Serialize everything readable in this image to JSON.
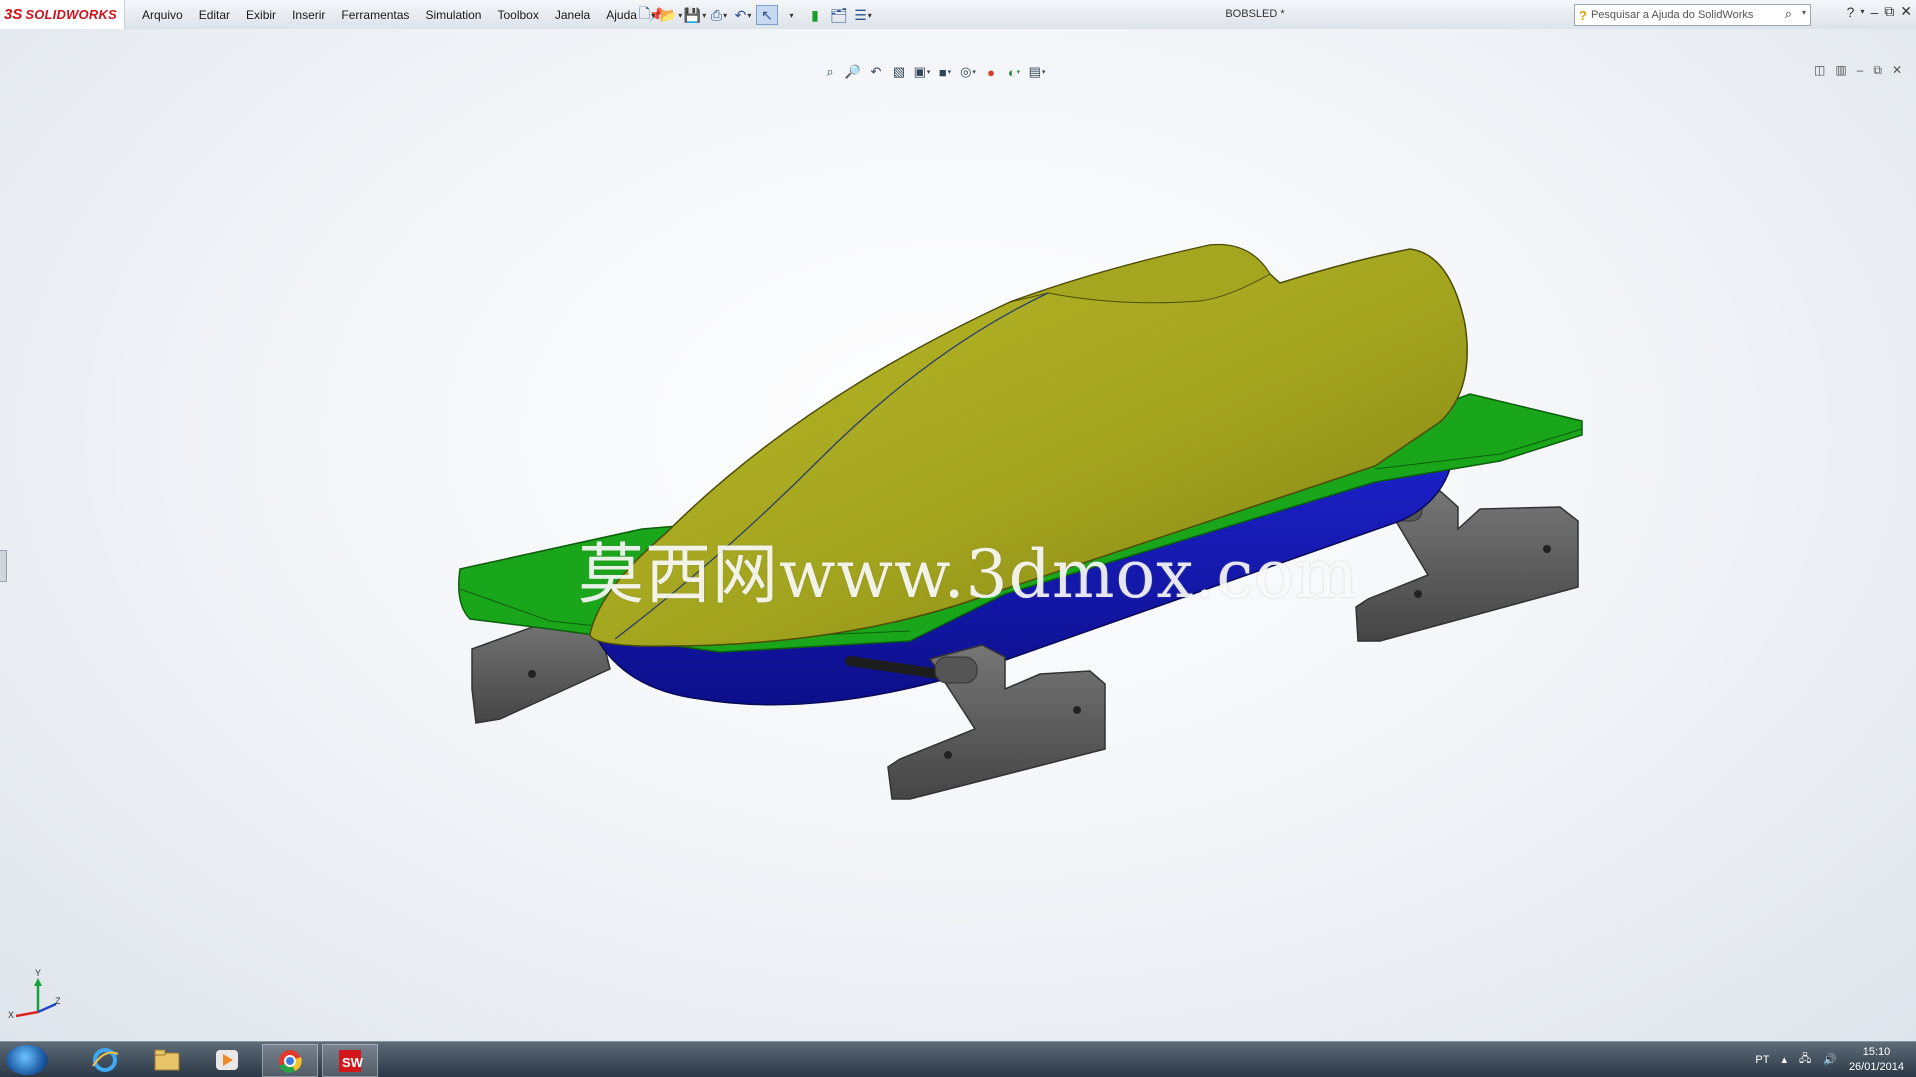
{
  "app": {
    "logo_ds": "3S",
    "brand": "SOLIDWORKS"
  },
  "menu": {
    "items": [
      {
        "label": "Arquivo"
      },
      {
        "label": "Editar"
      },
      {
        "label": "Exibir"
      },
      {
        "label": "Inserir"
      },
      {
        "label": "Ferramentas"
      },
      {
        "label": "Simulation"
      },
      {
        "label": "Toolbox"
      },
      {
        "label": "Janela"
      },
      {
        "label": "Ajuda"
      }
    ]
  },
  "document": {
    "title": "BOBSLED *"
  },
  "search": {
    "placeholder": "Pesquisar a Ajuda do SolidWorks"
  },
  "watermark": {
    "text": "莫西网www.3dmox.com"
  },
  "triad": {
    "x": "X",
    "y": "Y",
    "z": "Z"
  },
  "model_colors": {
    "body": "#a3a41e",
    "deck": "#1aa61a",
    "hull": "#1519b8",
    "runners": "#5b5b5b"
  },
  "tray": {
    "language": "PT",
    "time": "15:10",
    "date": "26/01/2014"
  }
}
